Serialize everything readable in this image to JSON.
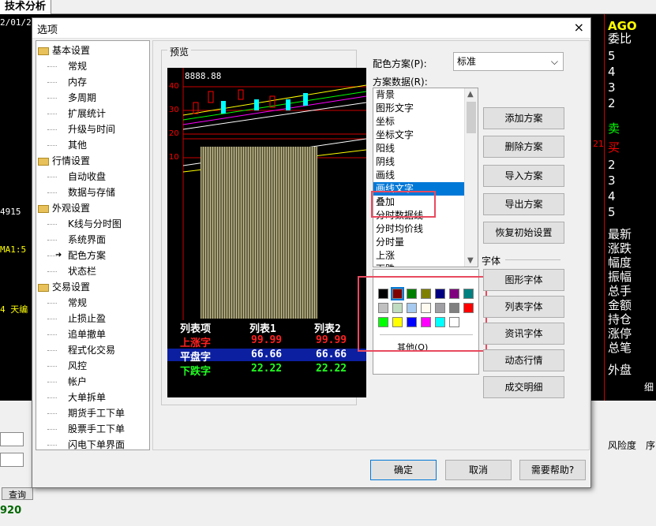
{
  "background": {
    "tab_label": "技术分析",
    "date_fragment": "2/01/2",
    "right_code": "AGO",
    "right_labels": [
      "委比",
      "5",
      "4",
      "3",
      "2",
      "卖",
      "买",
      "2",
      "3",
      "4",
      "5",
      "最新",
      "涨跌",
      "幅度",
      "振幅",
      "总手",
      "金额",
      "持仓",
      "涨停",
      "总笔",
      "外盘"
    ],
    "left_labels": [
      "4915",
      "MA1:5",
      "4 天编"
    ],
    "red_number": "21",
    "bottom_labels": {
      "risk": "风险度",
      "query": "查询",
      "number": "920",
      "seq": "序",
      "minus": "-",
      "fine": "细"
    }
  },
  "dialog": {
    "title": "选项",
    "close_icon": "×",
    "tree": [
      {
        "label": "基本设置",
        "type": "group"
      },
      {
        "label": "常规",
        "type": "leaf"
      },
      {
        "label": "内存",
        "type": "leaf"
      },
      {
        "label": "多周期",
        "type": "leaf"
      },
      {
        "label": "扩展统计",
        "type": "leaf"
      },
      {
        "label": "升级与时间",
        "type": "leaf"
      },
      {
        "label": "其他",
        "type": "leaf"
      },
      {
        "label": "行情设置",
        "type": "group"
      },
      {
        "label": "自动收盘",
        "type": "leaf"
      },
      {
        "label": "数据与存储",
        "type": "leaf"
      },
      {
        "label": "外观设置",
        "type": "group"
      },
      {
        "label": "K线与分时图",
        "type": "leaf"
      },
      {
        "label": "系统界面",
        "type": "leaf"
      },
      {
        "label": "配色方案",
        "type": "leaf",
        "selected": true
      },
      {
        "label": "状态栏",
        "type": "leaf"
      },
      {
        "label": "交易设置",
        "type": "group"
      },
      {
        "label": "常规",
        "type": "leaf"
      },
      {
        "label": "止损止盈",
        "type": "leaf"
      },
      {
        "label": "追单撤单",
        "type": "leaf"
      },
      {
        "label": "程式化交易",
        "type": "leaf"
      },
      {
        "label": "风控",
        "type": "leaf"
      },
      {
        "label": "帐户",
        "type": "leaf"
      },
      {
        "label": "大单拆单",
        "type": "leaf"
      },
      {
        "label": "期货手工下单",
        "type": "leaf"
      },
      {
        "label": "股票手工下单",
        "type": "leaf"
      },
      {
        "label": "闪电下单界面",
        "type": "leaf"
      }
    ],
    "preview": {
      "label": "预览",
      "price": "8888.88",
      "axis": [
        "40",
        "30",
        "20",
        "10"
      ],
      "table": {
        "headers": [
          "列表项",
          "列表1",
          "列表2"
        ],
        "rows": [
          {
            "label": "上涨字",
            "v1": "99.99",
            "v2": "99.99",
            "color": "#ff2020"
          },
          {
            "label": "平盘字",
            "v1": "66.66",
            "v2": "66.66",
            "color": "#ffffff"
          },
          {
            "label": "下跌字",
            "v1": "22.22",
            "v2": "22.22",
            "color": "#22ff22"
          }
        ]
      }
    },
    "scheme_label": "配色方案(P):",
    "scheme_value": "标准",
    "scheme_data_label": "方案数据(R):",
    "scheme_items": [
      "背景",
      "图形文字",
      "坐标",
      "坐标文字",
      "阳线",
      "阴线",
      "画线",
      "画线文字",
      "叠加",
      "分时数据线",
      "分时均价线",
      "分时量",
      "上涨",
      "下跌"
    ],
    "selected_item": "画线文字",
    "palette": {
      "colors": [
        "#000000",
        "#800000",
        "#008000",
        "#808000",
        "#000080",
        "#800080",
        "#008080",
        "#c0c0c0",
        "#c0dcc0",
        "#a6caf0",
        "#fffbf0",
        "#a0a0a4",
        "#808080",
        "#ff0000",
        "#00ff00",
        "#ffff00",
        "#0000ff",
        "#ff00ff",
        "#00ffff",
        "#ffffff"
      ],
      "selected_color": "#800000",
      "other_label": "其他(O)"
    },
    "buttons": [
      "添加方案",
      "删除方案",
      "导入方案",
      "导出方案",
      "恢复初始设置"
    ],
    "font_label": "字体",
    "font_buttons": [
      "图形字体",
      "列表字体",
      "资讯字体",
      "动态行情",
      "成交明细"
    ],
    "footer": {
      "ok": "确定",
      "cancel": "取消",
      "help": "需要帮助?"
    }
  }
}
